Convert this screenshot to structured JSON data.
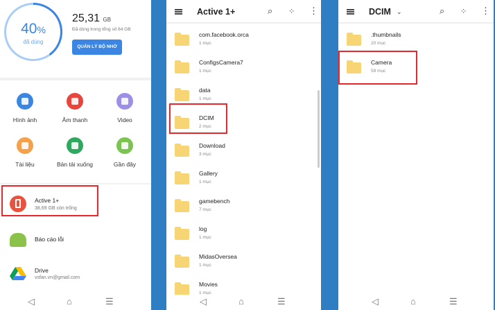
{
  "storage": {
    "percent": "40",
    "percent_sign": "%",
    "used_label": "đã dùng",
    "used_value": "25,31",
    "used_unit": "GB",
    "total_text": "Đã dùng trong tổng số 64 GB",
    "manage_button": "QUẢN LÝ BỘ NHỚ",
    "used_fraction": 0.4
  },
  "categories": [
    {
      "label": "Hình ảnh",
      "color": "#3b86e3",
      "icon": "image-icon"
    },
    {
      "label": "Âm thanh",
      "color": "#e8453c",
      "icon": "headphones-icon"
    },
    {
      "label": "Video",
      "color": "#9c8fe6",
      "icon": "video-icon"
    },
    {
      "label": "Tài liệu",
      "color": "#f5a04a",
      "icon": "document-icon"
    },
    {
      "label": "Bản tải xuống",
      "color": "#2fa860",
      "icon": "download-icon"
    },
    {
      "label": "Gần đây",
      "color": "#7bc451",
      "icon": "clock-icon"
    }
  ],
  "sources": [
    {
      "title": "Active 1+",
      "subtitle": "38,69 GB còn trống"
    },
    {
      "title": "Báo cáo lỗi",
      "subtitle": ""
    },
    {
      "title": "Drive",
      "subtitle": "vsfan.vn@gmail.com"
    }
  ],
  "panel2": {
    "title": "Active 1+",
    "folders": [
      {
        "name": "com.facebook.orca",
        "count": "1 mục"
      },
      {
        "name": "ConfigsCamera7",
        "count": "1 mục"
      },
      {
        "name": "data",
        "count": "1 mục"
      },
      {
        "name": "DCIM",
        "count": "2 mục"
      },
      {
        "name": "Download",
        "count": "3 mục"
      },
      {
        "name": "Gallery",
        "count": "1 mục"
      },
      {
        "name": "gamebench",
        "count": "7 mục"
      },
      {
        "name": "log",
        "count": "1 mục"
      },
      {
        "name": "MidasOversea",
        "count": "1 mục"
      },
      {
        "name": "Movies",
        "count": "1 mục"
      }
    ]
  },
  "panel3": {
    "title": "DCIM",
    "folders": [
      {
        "name": ".thumbnails",
        "count": "20 mục"
      },
      {
        "name": "Camera",
        "count": "59 mục"
      }
    ]
  },
  "nav": {
    "back": "◁",
    "home": "⌂",
    "menu": "☰"
  },
  "colors": {
    "accent": "#3b86e3",
    "highlight": "#e8262b",
    "separator": "#2f7dc2",
    "folder": "#f7d575"
  }
}
